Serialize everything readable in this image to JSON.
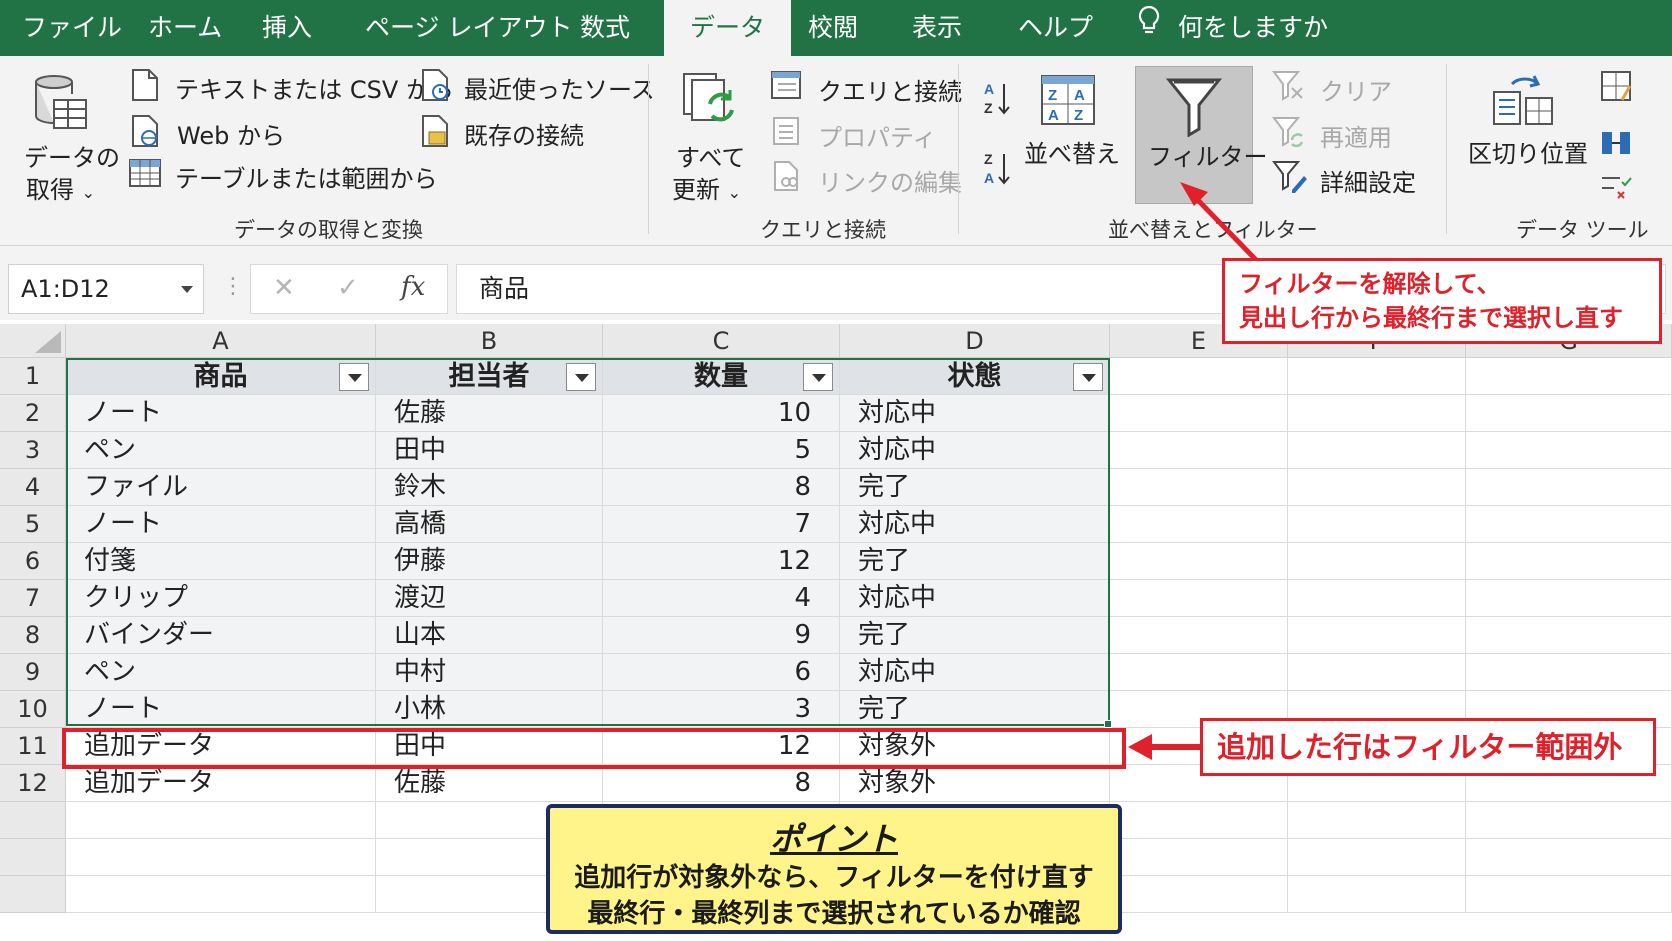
{
  "ribbon_tabs": [
    "ファイル",
    "ホーム",
    "挿入",
    "ページ レイアウト",
    "数式",
    "データ",
    "校閲",
    "表示",
    "ヘルプ"
  ],
  "active_tab": "データ",
  "tell_me": "何をしますか",
  "groups": {
    "get_transform": {
      "label": "データの取得と変換",
      "get_data": [
        "データの",
        "取得"
      ],
      "from_text_csv": "テキストまたは CSV から",
      "from_web": "Web から",
      "from_table": "テーブルまたは範囲から",
      "recent_sources": "最近使ったソース",
      "existing_connections": "既存の接続"
    },
    "queries": {
      "label": "クエリと接続",
      "refresh_all": [
        "すべて",
        "更新"
      ],
      "queries_connections": "クエリと接続",
      "properties": "プロパティ",
      "edit_links": "リンクの編集"
    },
    "sort_filter": {
      "label": "並べ替えとフィルター",
      "sort": "並べ替え",
      "filter": "フィルター",
      "clear": "クリア",
      "reapply": "再適用",
      "advanced": "詳細設定"
    },
    "data_tools": {
      "label": "データ ツール",
      "text_to_columns": "区切り位置"
    }
  },
  "formula_bar": {
    "name_box": "A1:D12",
    "fx": "fx",
    "content": "商品"
  },
  "columns": [
    "A",
    "B",
    "C",
    "D",
    "E",
    "F",
    "G"
  ],
  "header_row": [
    "商品",
    "担当者",
    "数量",
    "状態"
  ],
  "rows": [
    [
      "ノート",
      "佐藤",
      "10",
      "対応中"
    ],
    [
      "ペン",
      "田中",
      "5",
      "対応中"
    ],
    [
      "ファイル",
      "鈴木",
      "8",
      "完了"
    ],
    [
      "ノート",
      "高橋",
      "7",
      "対応中"
    ],
    [
      "付箋",
      "伊藤",
      "12",
      "完了"
    ],
    [
      "クリップ",
      "渡辺",
      "4",
      "対応中"
    ],
    [
      "バインダー",
      "山本",
      "9",
      "完了"
    ],
    [
      "ペン",
      "中村",
      "6",
      "対応中"
    ],
    [
      "ノート",
      "小林",
      "3",
      "完了"
    ],
    [
      "追加データ",
      "田中",
      "12",
      "対象外"
    ],
    [
      "追加データ",
      "佐藤",
      "8",
      "対象外"
    ]
  ],
  "annotations": {
    "filter_callout": [
      "フィルターを解除して、",
      "見出し行から最終行まで選択し直す"
    ],
    "row_callout": "追加した行はフィルター範囲外",
    "point": {
      "title": "ポイント",
      "lines": [
        "追加行が対象外なら、フィルターを付け直す",
        "最終行・最終列まで選択されているか確認"
      ]
    }
  },
  "colors": {
    "excel_green": "#217346",
    "accent_red": "#e0202a",
    "point_bg": "#fff48a",
    "point_border": "#1d2a66"
  }
}
